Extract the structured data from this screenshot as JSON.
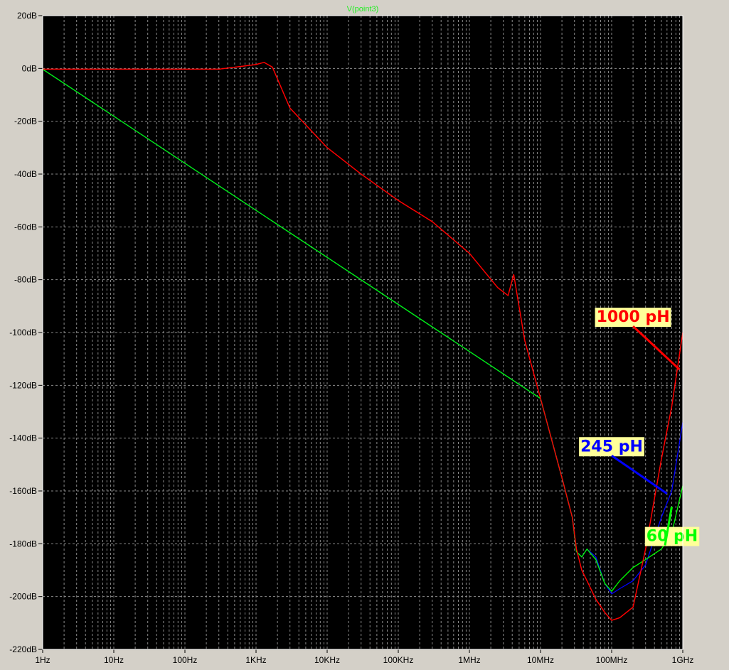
{
  "colors": {
    "plot_background": "#000000",
    "grid": "#8a8a8a",
    "frame": "#ffffff",
    "label_background": "#ffff99",
    "title": "#22ee22"
  },
  "chart_data": {
    "type": "line",
    "title": "V(point3)",
    "xlabel": "",
    "ylabel": "",
    "x_scale": "log",
    "xlim": [
      1,
      1000000000
    ],
    "ylim": [
      -220,
      20
    ],
    "grid": true,
    "x_tick_values": [
      1,
      10,
      100,
      1000,
      10000,
      100000,
      1000000,
      10000000,
      100000000,
      1000000000
    ],
    "x_tick_labels": [
      "1Hz",
      "10Hz",
      "100Hz",
      "1KHz",
      "10KHz",
      "100KHz",
      "1MHz",
      "10MHz",
      "100MHz",
      "1GHz"
    ],
    "y_tick_values": [
      20,
      0,
      -20,
      -40,
      -60,
      -80,
      -100,
      -120,
      -140,
      -160,
      -180,
      -200,
      -220
    ],
    "y_tick_labels": [
      "20dB",
      "0dB",
      "-20dB",
      "-40dB",
      "-60dB",
      "-80dB",
      "-100dB",
      "-120dB",
      "-140dB",
      "-160dB",
      "-180dB",
      "-200dB",
      "-220dB"
    ],
    "series": [
      {
        "name": "1000 pH",
        "color": "#ff0000",
        "x": [
          1,
          100,
          300,
          1000,
          1300,
          1700,
          3000,
          10000,
          30000,
          100000,
          300000,
          1000000,
          2500000,
          3500000,
          4200000,
          6000000,
          10000000,
          20000000,
          28000000,
          32000000,
          38000000,
          45000000,
          60000000,
          80000000,
          100000000,
          130000000,
          200000000,
          300000000,
          500000000,
          700000000,
          1000000000
        ],
        "y": [
          -0.3,
          -0.3,
          -0.3,
          1.5,
          2.3,
          0.5,
          -15,
          -30,
          -40,
          -50,
          -58,
          -70,
          -83,
          -86,
          -78,
          -103,
          -125,
          -155,
          -170,
          -182,
          -190,
          -194,
          -201,
          -206,
          -209,
          -208,
          -204,
          -182,
          -148,
          -128,
          -100
        ]
      },
      {
        "name": "245 pH",
        "color": "#0000ff",
        "x": [
          1,
          10000000,
          20000000,
          28000000,
          32000000,
          38000000,
          45000000,
          60000000,
          80000000,
          100000000,
          130000000,
          200000000,
          300000000,
          500000000,
          700000000,
          1000000000
        ],
        "y": [
          -0.3,
          -125,
          -155,
          -170,
          -183,
          -185,
          -182,
          -185,
          -195,
          -199,
          -197,
          -194,
          -188,
          -170,
          -160,
          -134
        ]
      },
      {
        "name": "60 pH",
        "color": "#00ff00",
        "x": [
          1,
          10000000,
          20000000,
          28000000,
          32000000,
          38000000,
          45000000,
          60000000,
          80000000,
          100000000,
          130000000,
          200000000,
          300000000,
          500000000,
          700000000,
          1000000000
        ],
        "y": [
          -0.3,
          -125,
          -155,
          -170,
          -183,
          -185,
          -182,
          -186,
          -195,
          -198,
          -194,
          -189,
          -186,
          -182,
          -176,
          -158
        ]
      }
    ],
    "annotations": [
      {
        "text": "1000 pH",
        "color": "#ff0000",
        "x": 200000000,
        "y": -96,
        "point_x": 900000000,
        "point_y": -114
      },
      {
        "text": "245 pH",
        "color": "#0000ff",
        "x": 100000000,
        "y": -145,
        "point_x": 600000000,
        "point_y": -161
      },
      {
        "text": "60 pH",
        "color": "#00ff00",
        "x": 1350000000,
        "y": -179,
        "point_x": 700000000,
        "point_y": -166
      }
    ]
  }
}
